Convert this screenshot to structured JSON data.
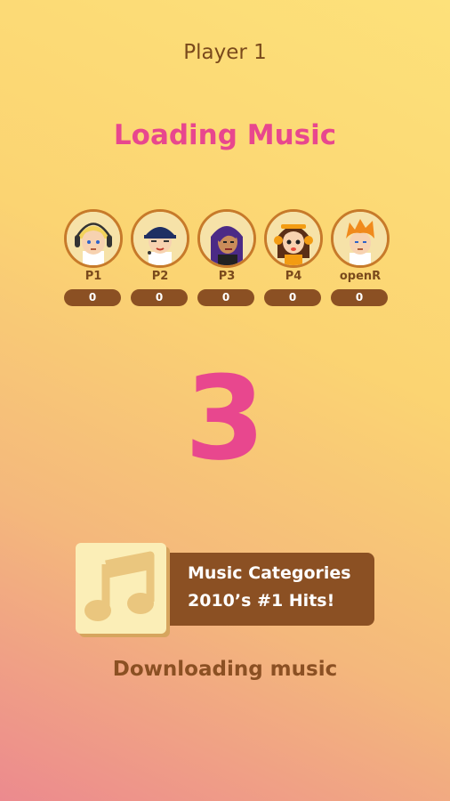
{
  "header": {
    "player_label": "Player 1"
  },
  "status": {
    "title": "Loading Music"
  },
  "players": [
    {
      "name": "P1",
      "score": "0",
      "avatar_icon": "blonde-headphones-avatar-icon"
    },
    {
      "name": "P2",
      "score": "0",
      "avatar_icon": "navy-cap-avatar-icon"
    },
    {
      "name": "P3",
      "score": "0",
      "avatar_icon": "purple-hair-avatar-icon"
    },
    {
      "name": "P4",
      "score": "0",
      "avatar_icon": "orange-headset-avatar-icon"
    },
    {
      "name": "openR",
      "score": "0",
      "avatar_icon": "orange-spiky-hair-avatar-icon"
    }
  ],
  "countdown": {
    "value": "3"
  },
  "category": {
    "icon": "music-note-icon",
    "line1": "Music Categories",
    "line2": "2010’s #1 Hits!"
  },
  "footer": {
    "download_label": "Downloading music"
  },
  "colors": {
    "accent_pink": "#e8478e",
    "brown": "#8b5023",
    "avatar_border": "#c77a2a"
  }
}
